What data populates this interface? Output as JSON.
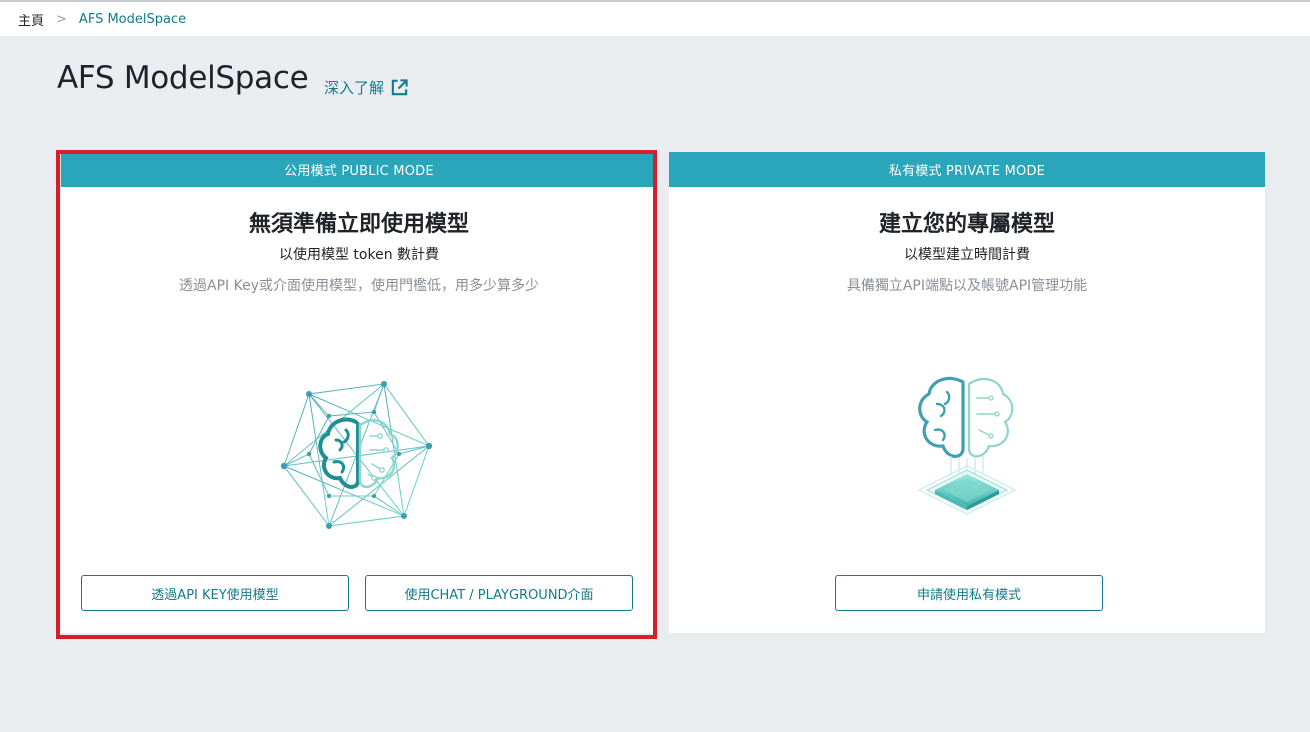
{
  "breadcrumb": {
    "home": "主頁",
    "separator": ">",
    "current": "AFS ModelSpace"
  },
  "page": {
    "title": "AFS ModelSpace",
    "learn_more": "深入了解",
    "learn_more_icon": "external-link-icon"
  },
  "public_card": {
    "header": "公用模式 PUBLIC MODE",
    "title": "無須準備立即使用模型",
    "subtitle": "以使用模型 token 數計費",
    "description": "透過API Key或介面使用模型，使用門檻低，用多少算多少",
    "illustration": "brain-network-icon",
    "buttons": {
      "api": "透過API KEY使用模型",
      "chat": "使用CHAT / PLAYGROUND介面"
    }
  },
  "private_card": {
    "header": "私有模式 PRIVATE MODE",
    "title": "建立您的專屬模型",
    "subtitle": "以模型建立時間計費",
    "description": "具備獨立API端點以及帳號API管理功能",
    "illustration": "brain-chip-icon",
    "buttons": {
      "apply": "申請使用私有模式"
    }
  },
  "colors": {
    "accent": "#137a8c",
    "header": "#2aa5b9",
    "highlight": "#d71f2b",
    "background": "#eaedf0"
  }
}
